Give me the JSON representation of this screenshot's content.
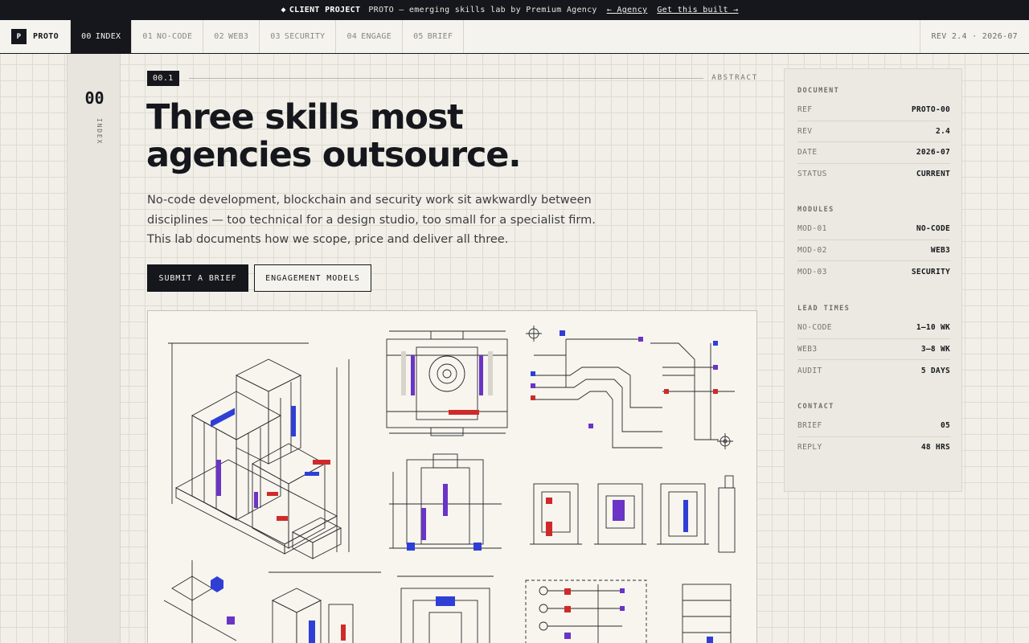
{
  "announcement": {
    "badge": "CLIENT PROJECT",
    "badge_icon": "diamond-icon",
    "description": "PROTO — emerging skills lab by Premium Agency",
    "back_link": "← Agency",
    "cta_link": "Get this built →"
  },
  "nav": {
    "brand_logo_letter": "P",
    "brand_name": "PROTO",
    "tabs": [
      {
        "num": "00",
        "label": "INDEX",
        "active": true
      },
      {
        "num": "01",
        "label": "NO-CODE"
      },
      {
        "num": "02",
        "label": "WEB3"
      },
      {
        "num": "03",
        "label": "SECURITY"
      },
      {
        "num": "04",
        "label": "ENGAGE"
      },
      {
        "num": "05",
        "label": "BRIEF"
      }
    ],
    "revision": "REV 2.4 · 2026-07"
  },
  "rail": {
    "number": "00",
    "label": "INDEX"
  },
  "hero": {
    "section_number": "00.1",
    "section_label": "ABSTRACT",
    "headline_line1": "Three skills most",
    "headline_line2": "agencies outsource.",
    "lede": "No-code development, blockchain and security work sit awkwardly between disciplines — too technical for a design studio, too small for a specialist firm. This lab documents how we scope, price and deliver all three.",
    "primary_button": "SUBMIT A BRIEF",
    "secondary_button": "ENGAGEMENT MODELS"
  },
  "figure": {
    "accent_blue": "#2f3fd6",
    "accent_red": "#cf2a2a",
    "accent_purple": "#6a34c6"
  },
  "panel": {
    "document": {
      "title": "DOCUMENT",
      "rows": [
        {
          "k": "REF",
          "v": "PROTO-00"
        },
        {
          "k": "REV",
          "v": "2.4"
        },
        {
          "k": "DATE",
          "v": "2026-07"
        },
        {
          "k": "STATUS",
          "v": "CURRENT"
        }
      ]
    },
    "modules": {
      "title": "MODULES",
      "rows": [
        {
          "k": "MOD-01",
          "v": "NO-CODE"
        },
        {
          "k": "MOD-02",
          "v": "WEB3"
        },
        {
          "k": "MOD-03",
          "v": "SECURITY"
        }
      ]
    },
    "lead_times": {
      "title": "LEAD TIMES",
      "rows": [
        {
          "k": "NO-CODE",
          "v": "1–10 WK"
        },
        {
          "k": "WEB3",
          "v": "3–8 WK"
        },
        {
          "k": "AUDIT",
          "v": "5 DAYS"
        }
      ]
    },
    "contact": {
      "title": "CONTACT",
      "rows": [
        {
          "k": "BRIEF",
          "v": "05"
        },
        {
          "k": "REPLY",
          "v": "48 HRS"
        }
      ]
    }
  }
}
